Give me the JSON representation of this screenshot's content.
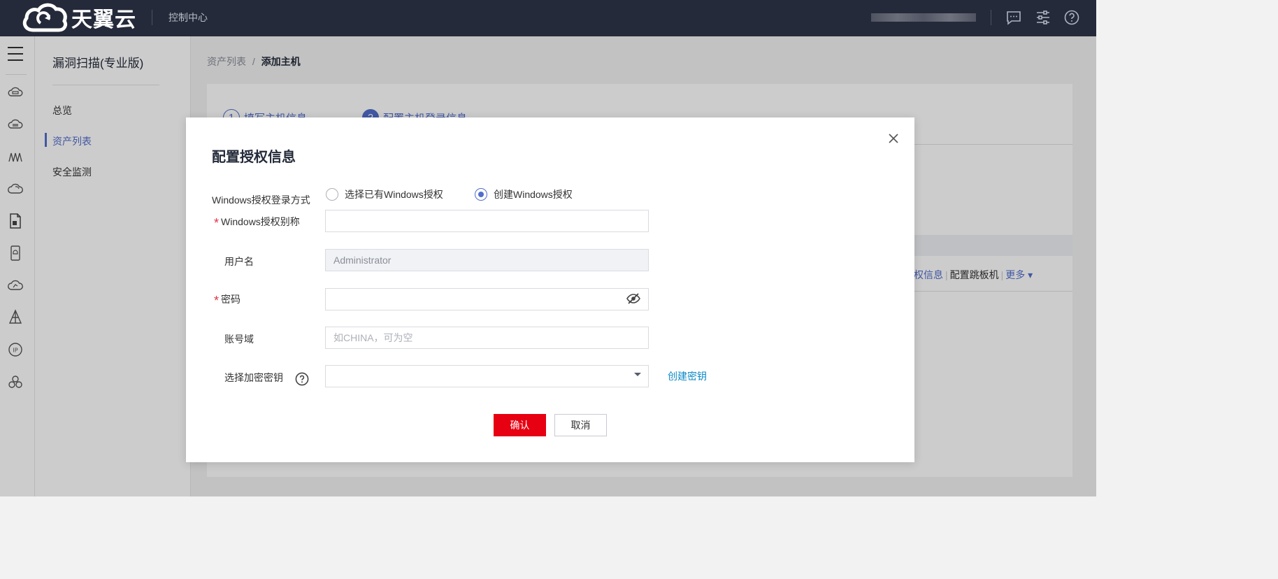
{
  "header": {
    "logo_text": "天翼云",
    "console_label": "控制中心",
    "icons": [
      "message-icon",
      "settings-sliders-icon",
      "help-icon"
    ]
  },
  "rail": {
    "icons": [
      "menu-icon",
      "cloud-server-icon",
      "cloud-host-icon",
      "network-icon",
      "cloud-icon",
      "document-icon",
      "storage-icon",
      "monitor-icon",
      "stack-icon",
      "ip-icon",
      "cluster-icon"
    ]
  },
  "sidebar": {
    "title": "漏洞扫描(专业版)",
    "items": [
      {
        "label": "总览",
        "active": false
      },
      {
        "label": "资产列表",
        "active": true
      },
      {
        "label": "安全监测",
        "active": false
      }
    ]
  },
  "breadcrumb": {
    "parent": "资产列表",
    "separator": "/",
    "current": "添加主机"
  },
  "background": {
    "step1_num": "1",
    "step1_label": "填写主机信息",
    "step2_num": "2",
    "step2_label": "配置主机登录信息",
    "row_links": {
      "auth_info": "权信息",
      "jump_host": "配置跳板机",
      "more": "更多"
    }
  },
  "modal": {
    "title": "配置授权信息",
    "login_mode_label": "Windows授权登录方式",
    "radio_existing": "选择已有Windows授权",
    "radio_create": "创建Windows授权",
    "alias_label": "Windows授权别称",
    "alias_value": "",
    "username_label": "用户名",
    "username_value": "Administrator",
    "password_label": "密码",
    "password_value": "",
    "domain_label": "账号域",
    "domain_placeholder": "如CHINA，可为空",
    "key_label": "选择加密密钥",
    "key_value": "",
    "create_key_link": "创建密钥",
    "confirm_button": "确认",
    "cancel_button": "取消"
  },
  "colors": {
    "brand_red": "#e60012",
    "accent_blue": "#526ecc",
    "link_blue": "#0d8ac7",
    "header_bg": "#252a3a"
  }
}
